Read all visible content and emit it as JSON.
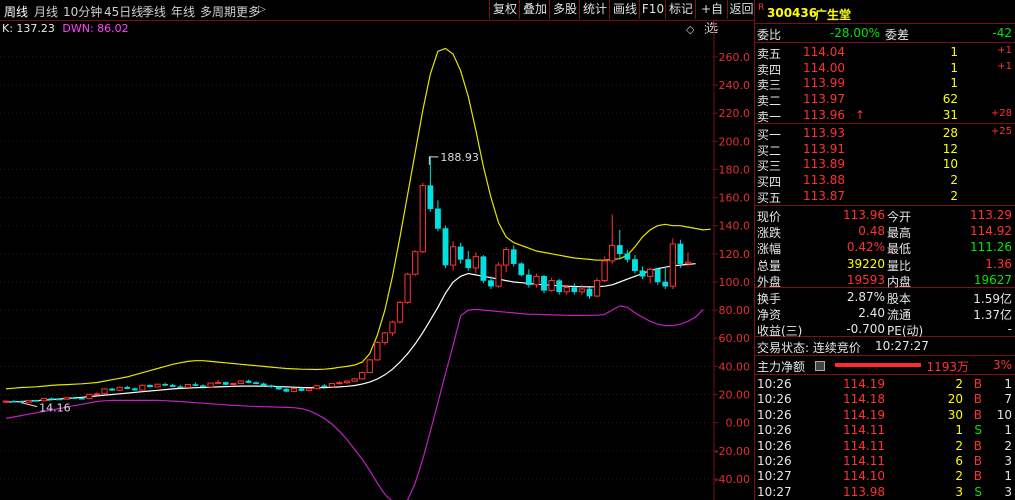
{
  "toolbar": {
    "left_tabs": [
      "周线",
      "月线",
      "10分钟",
      "45日线",
      "季线",
      "年线",
      "多周期",
      "更多"
    ],
    "more_arrow": "▷",
    "right_buttons": [
      "复权",
      "叠加",
      "多股",
      "统计",
      "画线",
      "F10",
      "标记",
      "+自选",
      "返回"
    ]
  },
  "indicator": {
    "k_label": "K: 137.23",
    "d_label": "DWN: 86.02"
  },
  "chart_data": {
    "type": "candlestick",
    "y_ticks": [
      "260.0",
      "240.0",
      "220.0",
      "200.0",
      "180.0",
      "160.0",
      "140.0",
      "120.0",
      "100.0",
      "80.00",
      "60.00",
      "40.00",
      "20.00",
      "0.00",
      "-20.00",
      "-40.00"
    ],
    "ylim": [
      -55,
      272
    ],
    "annotations": {
      "high_label": "188.93",
      "low_label": "14.16"
    },
    "colors": {
      "up": "#ff3232",
      "down": "#00e0e0",
      "mid": "#ffffff",
      "upper": "#e6e600",
      "lower": "#c020c0"
    },
    "candles": [
      [
        15,
        15.6,
        14.6,
        15.3
      ],
      [
        15.3,
        15.8,
        14.9,
        15.1
      ],
      [
        15.1,
        15.4,
        14.2,
        14.5
      ],
      [
        14.5,
        16.0,
        14.3,
        15.8
      ],
      [
        15.8,
        16.3,
        15.2,
        15.5
      ],
      [
        15.5,
        17.5,
        15.3,
        17.1
      ],
      [
        17.1,
        17.8,
        16.5,
        16.8
      ],
      [
        16.8,
        17.2,
        16.2,
        16.6
      ],
      [
        16.6,
        18.0,
        16.4,
        17.7
      ],
      [
        17.7,
        18.2,
        17.0,
        17.3
      ],
      [
        17.3,
        17.6,
        16.7,
        17.0
      ],
      [
        17,
        20.5,
        16.9,
        20.1
      ],
      [
        20.1,
        21.5,
        19.5,
        20.5
      ],
      [
        20.5,
        24.5,
        20.3,
        24.0
      ],
      [
        24,
        24.8,
        22.5,
        23.0
      ],
      [
        23,
        25.6,
        22.6,
        25.1
      ],
      [
        25.1,
        26.2,
        23.8,
        24.2
      ],
      [
        24.2,
        25.0,
        22.8,
        23.1
      ],
      [
        23.1,
        27.1,
        22.9,
        26.6
      ],
      [
        26.6,
        27.0,
        25.0,
        25.4
      ],
      [
        25.4,
        27.9,
        25.0,
        27.3
      ],
      [
        27.3,
        28.4,
        26.1,
        26.5
      ],
      [
        26.5,
        27.6,
        25.3,
        25.6
      ],
      [
        25.6,
        26.8,
        24.6,
        25.0
      ],
      [
        25,
        27.5,
        24.8,
        27.1
      ],
      [
        27.1,
        28.6,
        26.0,
        26.3
      ],
      [
        26.3,
        27.2,
        25.1,
        25.4
      ],
      [
        25.4,
        28.4,
        25.0,
        28.1
      ],
      [
        28.1,
        30.5,
        27.7,
        28.6
      ],
      [
        28.6,
        29.2,
        26.7,
        27.1
      ],
      [
        27.1,
        28.3,
        26.2,
        27.8
      ],
      [
        27.8,
        30.2,
        27.3,
        29.6
      ],
      [
        29.6,
        30.5,
        28.0,
        28.5
      ],
      [
        28.5,
        29.4,
        27.2,
        27.6
      ],
      [
        27.6,
        28.5,
        26.0,
        26.3
      ],
      [
        26.3,
        27.1,
        24.8,
        25.4
      ],
      [
        25.4,
        26.2,
        23.3,
        23.8
      ],
      [
        23.8,
        24.6,
        21.5,
        22.2
      ],
      [
        22.2,
        24.7,
        21.7,
        24.2
      ],
      [
        24.2,
        25.0,
        22.4,
        22.8
      ],
      [
        22.8,
        24.6,
        22.2,
        24.1
      ],
      [
        24.1,
        26.7,
        23.8,
        26.2
      ],
      [
        26.2,
        27.5,
        25.1,
        25.5
      ],
      [
        25.5,
        28.3,
        25.1,
        27.8
      ],
      [
        27.8,
        29.6,
        27.1,
        28.4
      ],
      [
        28.4,
        30.2,
        27.6,
        29.5
      ],
      [
        29.5,
        31.7,
        29.0,
        31.1
      ],
      [
        31.1,
        36.2,
        30.8,
        35.6
      ],
      [
        35.6,
        45.3,
        35.2,
        44.6
      ],
      [
        44.6,
        57.8,
        44.0,
        57.0
      ],
      [
        57,
        64.5,
        55.3,
        63.8
      ],
      [
        63.8,
        72.5,
        61.8,
        71.5
      ],
      [
        71.5,
        86.5,
        70.5,
        85.5
      ],
      [
        85.5,
        106.5,
        84.5,
        105.5
      ],
      [
        105.5,
        122.5,
        104.5,
        121.5
      ],
      [
        121.5,
        170.5,
        120.5,
        168.5
      ],
      [
        168.5,
        188.9,
        150,
        152
      ],
      [
        152,
        158,
        136,
        138
      ],
      [
        138,
        140,
        110,
        112
      ],
      [
        112,
        129,
        108,
        125
      ],
      [
        125,
        128,
        113,
        116
      ],
      [
        116,
        122,
        108,
        110
      ],
      [
        110,
        121,
        106,
        118
      ],
      [
        118,
        119,
        99,
        101
      ],
      [
        101,
        104,
        95,
        97
      ],
      [
        97,
        114,
        96,
        112
      ],
      [
        112,
        125,
        107,
        123
      ],
      [
        123,
        126,
        111,
        113
      ],
      [
        113,
        114,
        104,
        105
      ],
      [
        105,
        109,
        96,
        98
      ],
      [
        98,
        106,
        96,
        104
      ],
      [
        104,
        105,
        92,
        94
      ],
      [
        94,
        103,
        93,
        101
      ],
      [
        101,
        102,
        91,
        93
      ],
      [
        93,
        98,
        91,
        96
      ],
      [
        96,
        99,
        91,
        93
      ],
      [
        93,
        98,
        91,
        95
      ],
      [
        95,
        96,
        88,
        90
      ],
      [
        90,
        103,
        89,
        101
      ],
      [
        101,
        118,
        100,
        115
      ],
      [
        115,
        148,
        113,
        126
      ],
      [
        126,
        137,
        116,
        120
      ],
      [
        120,
        123,
        114,
        116
      ],
      [
        116,
        119,
        106,
        108
      ],
      [
        108,
        111,
        102,
        104
      ],
      [
        104,
        110,
        99,
        109
      ],
      [
        109,
        110,
        98,
        100
      ],
      [
        100,
        111,
        95,
        97
      ],
      [
        97,
        131,
        95,
        127
      ],
      [
        127,
        130,
        110,
        113
      ],
      [
        113,
        121,
        111,
        114
      ]
    ],
    "upper_band": [
      24,
      24.5,
      25,
      25.2,
      25.5,
      26,
      26.5,
      26.8,
      27,
      27.3,
      27.6,
      28,
      28.5,
      29.5,
      30.5,
      31.5,
      32.5,
      34,
      35.5,
      37,
      38.5,
      40,
      41.5,
      42.5,
      43.5,
      44,
      44,
      43.5,
      43,
      42.5,
      42,
      41.5,
      41,
      40.5,
      40,
      39.5,
      39,
      38.5,
      38.2,
      38,
      37.9,
      37.8,
      38,
      38.5,
      39.3,
      40,
      41,
      43,
      49,
      62,
      80,
      104,
      132,
      162,
      192,
      222,
      248,
      264,
      266,
      262,
      250,
      232,
      208,
      182,
      160,
      142,
      132,
      128,
      126,
      124,
      122,
      121,
      120,
      119,
      118,
      117,
      116.5,
      116,
      115.5,
      115.5,
      116,
      116.5,
      119,
      125,
      132,
      137,
      140,
      141,
      140,
      140,
      139,
      138,
      137,
      137.5
    ],
    "mid_line": [
      14.5,
      14.8,
      15,
      15.3,
      15.6,
      16,
      16.4,
      16.8,
      17.2,
      17.6,
      18,
      18.5,
      19,
      19.5,
      20,
      20.5,
      21,
      21.5,
      22,
      22.5,
      23,
      23.5,
      24,
      24.3,
      24.6,
      24.8,
      25,
      25.2,
      25.4,
      25.6,
      25.8,
      26,
      26,
      26,
      26,
      25.8,
      25.6,
      25.4,
      25.2,
      25,
      24.9,
      24.8,
      24.9,
      25.1,
      25.4,
      25.8,
      26.4,
      27.4,
      28.8,
      31,
      34,
      38,
      43,
      49,
      56,
      64,
      73,
      82,
      92,
      100,
      104,
      106,
      105,
      104,
      103,
      102,
      101,
      100,
      99.5,
      99,
      98.5,
      98,
      97.6,
      97.3,
      97,
      96.8,
      96.6,
      96.5,
      96.6,
      97,
      98,
      100,
      102,
      104,
      106,
      108,
      109.5,
      110.5,
      111.5,
      112,
      112.5,
      113
    ],
    "lower_band": [
      3,
      4,
      5,
      6,
      7,
      8,
      9,
      10,
      11,
      12,
      13,
      14,
      15,
      15.5,
      15.8,
      15.8,
      15.8,
      15.8,
      15.8,
      15.8,
      15.8,
      15.6,
      15.3,
      15,
      14.6,
      14.2,
      13.8,
      13.4,
      13,
      12.6,
      12.3,
      12,
      11.7,
      11.5,
      11.3,
      11.2,
      11,
      10.8,
      10.6,
      10,
      8.5,
      6,
      3,
      -1,
      -6,
      -12,
      -19,
      -26,
      -34,
      -43,
      -51,
      -56,
      -59,
      -55,
      -43,
      -26,
      -6,
      14,
      35,
      55,
      76,
      80,
      80.5,
      80,
      79.5,
      79,
      78.5,
      78,
      77.5,
      77,
      77,
      76.8,
      76.6,
      76.5,
      76.3,
      76.2,
      76.2,
      76.3,
      76.3,
      77,
      80,
      83,
      82,
      78,
      75,
      72,
      70,
      69,
      69,
      70,
      72,
      75,
      80.5
    ]
  },
  "quote_header": {
    "badge": "R",
    "code": "300436",
    "name": "广生堂"
  },
  "order_ratio": {
    "label": "委比",
    "value": "-28.00%",
    "diff_label": "委差",
    "diff_value": "-42"
  },
  "asks": [
    {
      "label": "卖五",
      "price": "114.04",
      "vol": "1",
      "chg": "+1",
      "arrow": ""
    },
    {
      "label": "卖四",
      "price": "114.00",
      "vol": "1",
      "chg": "+1",
      "arrow": ""
    },
    {
      "label": "卖三",
      "price": "113.99",
      "vol": "1",
      "chg": "",
      "arrow": ""
    },
    {
      "label": "卖二",
      "price": "113.97",
      "vol": "62",
      "chg": "",
      "arrow": ""
    },
    {
      "label": "卖一",
      "price": "113.96",
      "vol": "31",
      "chg": "+28",
      "arrow": "↑"
    }
  ],
  "bids": [
    {
      "label": "买一",
      "price": "113.93",
      "vol": "28",
      "chg": "+25"
    },
    {
      "label": "买二",
      "price": "113.91",
      "vol": "12",
      "chg": ""
    },
    {
      "label": "买三",
      "price": "113.89",
      "vol": "10",
      "chg": ""
    },
    {
      "label": "买四",
      "price": "113.88",
      "vol": "2",
      "chg": ""
    },
    {
      "label": "买五",
      "price": "113.87",
      "vol": "2",
      "chg": ""
    }
  ],
  "stats": [
    {
      "l1": "现价",
      "v1": "113.96",
      "l2": "今开",
      "v2": "113.29"
    },
    {
      "l1": "涨跌",
      "v1": "0.48",
      "l2": "最高",
      "v2": "114.92"
    },
    {
      "l1": "涨幅",
      "v1": "0.42%",
      "l2": "最低",
      "v2": "111.26"
    },
    {
      "l1": "总量",
      "v1": "39220",
      "l2": "量比",
      "v2": "1.36"
    },
    {
      "l1": "外盘",
      "v1": "19593",
      "l2": "内盘",
      "v2": "19627"
    }
  ],
  "fundamentals": [
    {
      "l1": "换手",
      "v1": "2.87%",
      "l2": "股本",
      "v2": "1.59亿"
    },
    {
      "l1": "净资",
      "v1": "2.40",
      "l2": "流通",
      "v2": "1.37亿"
    },
    {
      "l1": "收益(三)",
      "v1": "-0.700",
      "l2": "PE(动)",
      "v2": "-"
    }
  ],
  "trade_status": {
    "label": "交易状态: 连续竞价",
    "time": "10:27:27"
  },
  "main_flow": {
    "label": "主力净额",
    "value": "1193万",
    "pct": "3%"
  },
  "ticks": [
    {
      "time": "10:26",
      "price": "114.19",
      "vol": "2",
      "side": "B",
      "count": "1"
    },
    {
      "time": "10:26",
      "price": "114.18",
      "vol": "20",
      "side": "B",
      "count": "7"
    },
    {
      "time": "10:26",
      "price": "114.19",
      "vol": "30",
      "side": "B",
      "count": "10"
    },
    {
      "time": "10:26",
      "price": "114.11",
      "vol": "1",
      "side": "S",
      "count": "1"
    },
    {
      "time": "10:26",
      "price": "114.11",
      "vol": "2",
      "side": "B",
      "count": "2"
    },
    {
      "time": "10:26",
      "price": "114.11",
      "vol": "6",
      "side": "B",
      "count": "3"
    },
    {
      "time": "10:27",
      "price": "114.10",
      "vol": "2",
      "side": "B",
      "count": "1"
    },
    {
      "time": "10:27",
      "price": "113.98",
      "vol": "3",
      "side": "S",
      "count": "3"
    }
  ]
}
